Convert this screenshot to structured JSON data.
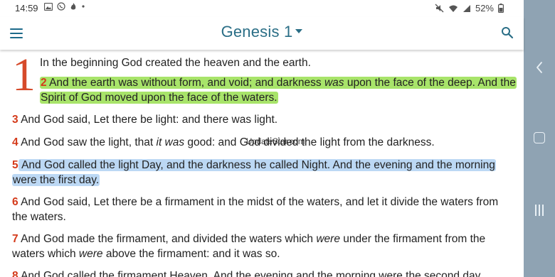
{
  "status_bar": {
    "time": "14:59",
    "battery": "52%",
    "left_icons": [
      "image-icon",
      "whatsapp-icon",
      "fire-icon",
      "dot-icon"
    ],
    "right_icons": [
      "mute-icon",
      "wifi-icon",
      "signal-icon",
      "battery-icon"
    ]
  },
  "app_bar": {
    "title": "Genesis 1",
    "menu_icon": "hamburger-menu-icon",
    "search_icon": "search-icon",
    "accent": "#2a6e86"
  },
  "chapter": {
    "number": "1",
    "color": "#d64a2a"
  },
  "verses": [
    {
      "num": "",
      "parts": [
        {
          "t": "In the beginning God created the heaven and the earth.",
          "i": false
        }
      ]
    },
    {
      "num": "2",
      "highlight": "green",
      "parts": [
        {
          "t": " And the earth was without form, and void; and darkness ",
          "i": false
        },
        {
          "t": "was",
          "i": true
        },
        {
          "t": " upon the face of the deep. And the Spirit of God moved upon the face of the waters.",
          "i": false
        }
      ]
    },
    {
      "num": "3",
      "parts": [
        {
          "t": " And God said, Let there be light: and there was light.",
          "i": false
        }
      ]
    },
    {
      "num": "4",
      "parts": [
        {
          "t": " And God saw the light, that ",
          "i": false
        },
        {
          "t": "it was",
          "i": true
        },
        {
          "t": " good: and God divided the light from the darkness.",
          "i": false
        }
      ]
    },
    {
      "num": "5",
      "highlight": "blue",
      "parts": [
        {
          "t": " And God called the light Day, and the darkness he called Night. And the evening and the morning were the first day.",
          "i": false
        }
      ]
    },
    {
      "num": "6",
      "parts": [
        {
          "t": " And God said, Let there be a firmament in the midst of the waters, and let it divide the waters from the waters.",
          "i": false
        }
      ]
    },
    {
      "num": "7",
      "parts": [
        {
          "t": " And God made the firmament, and divided the waters which ",
          "i": false
        },
        {
          "t": "were",
          "i": true
        },
        {
          "t": " under the firmament from the waters which ",
          "i": false
        },
        {
          "t": "were",
          "i": true
        },
        {
          "t": " above the firmament: and it was so.",
          "i": false
        }
      ]
    },
    {
      "num": "8",
      "parts": [
        {
          "t": " And God called the firmament Heaven. And the evening and the morning were the second day.",
          "i": false
        }
      ]
    }
  ],
  "watermark": "UpdateStar.com",
  "highlight_colors": {
    "green": "#a8e46a",
    "blue": "#bcd8f4"
  },
  "nav_bar": {
    "icons": [
      "back-icon",
      "home-icon",
      "recent-apps-icon"
    ],
    "color": "#8fa3b3"
  }
}
